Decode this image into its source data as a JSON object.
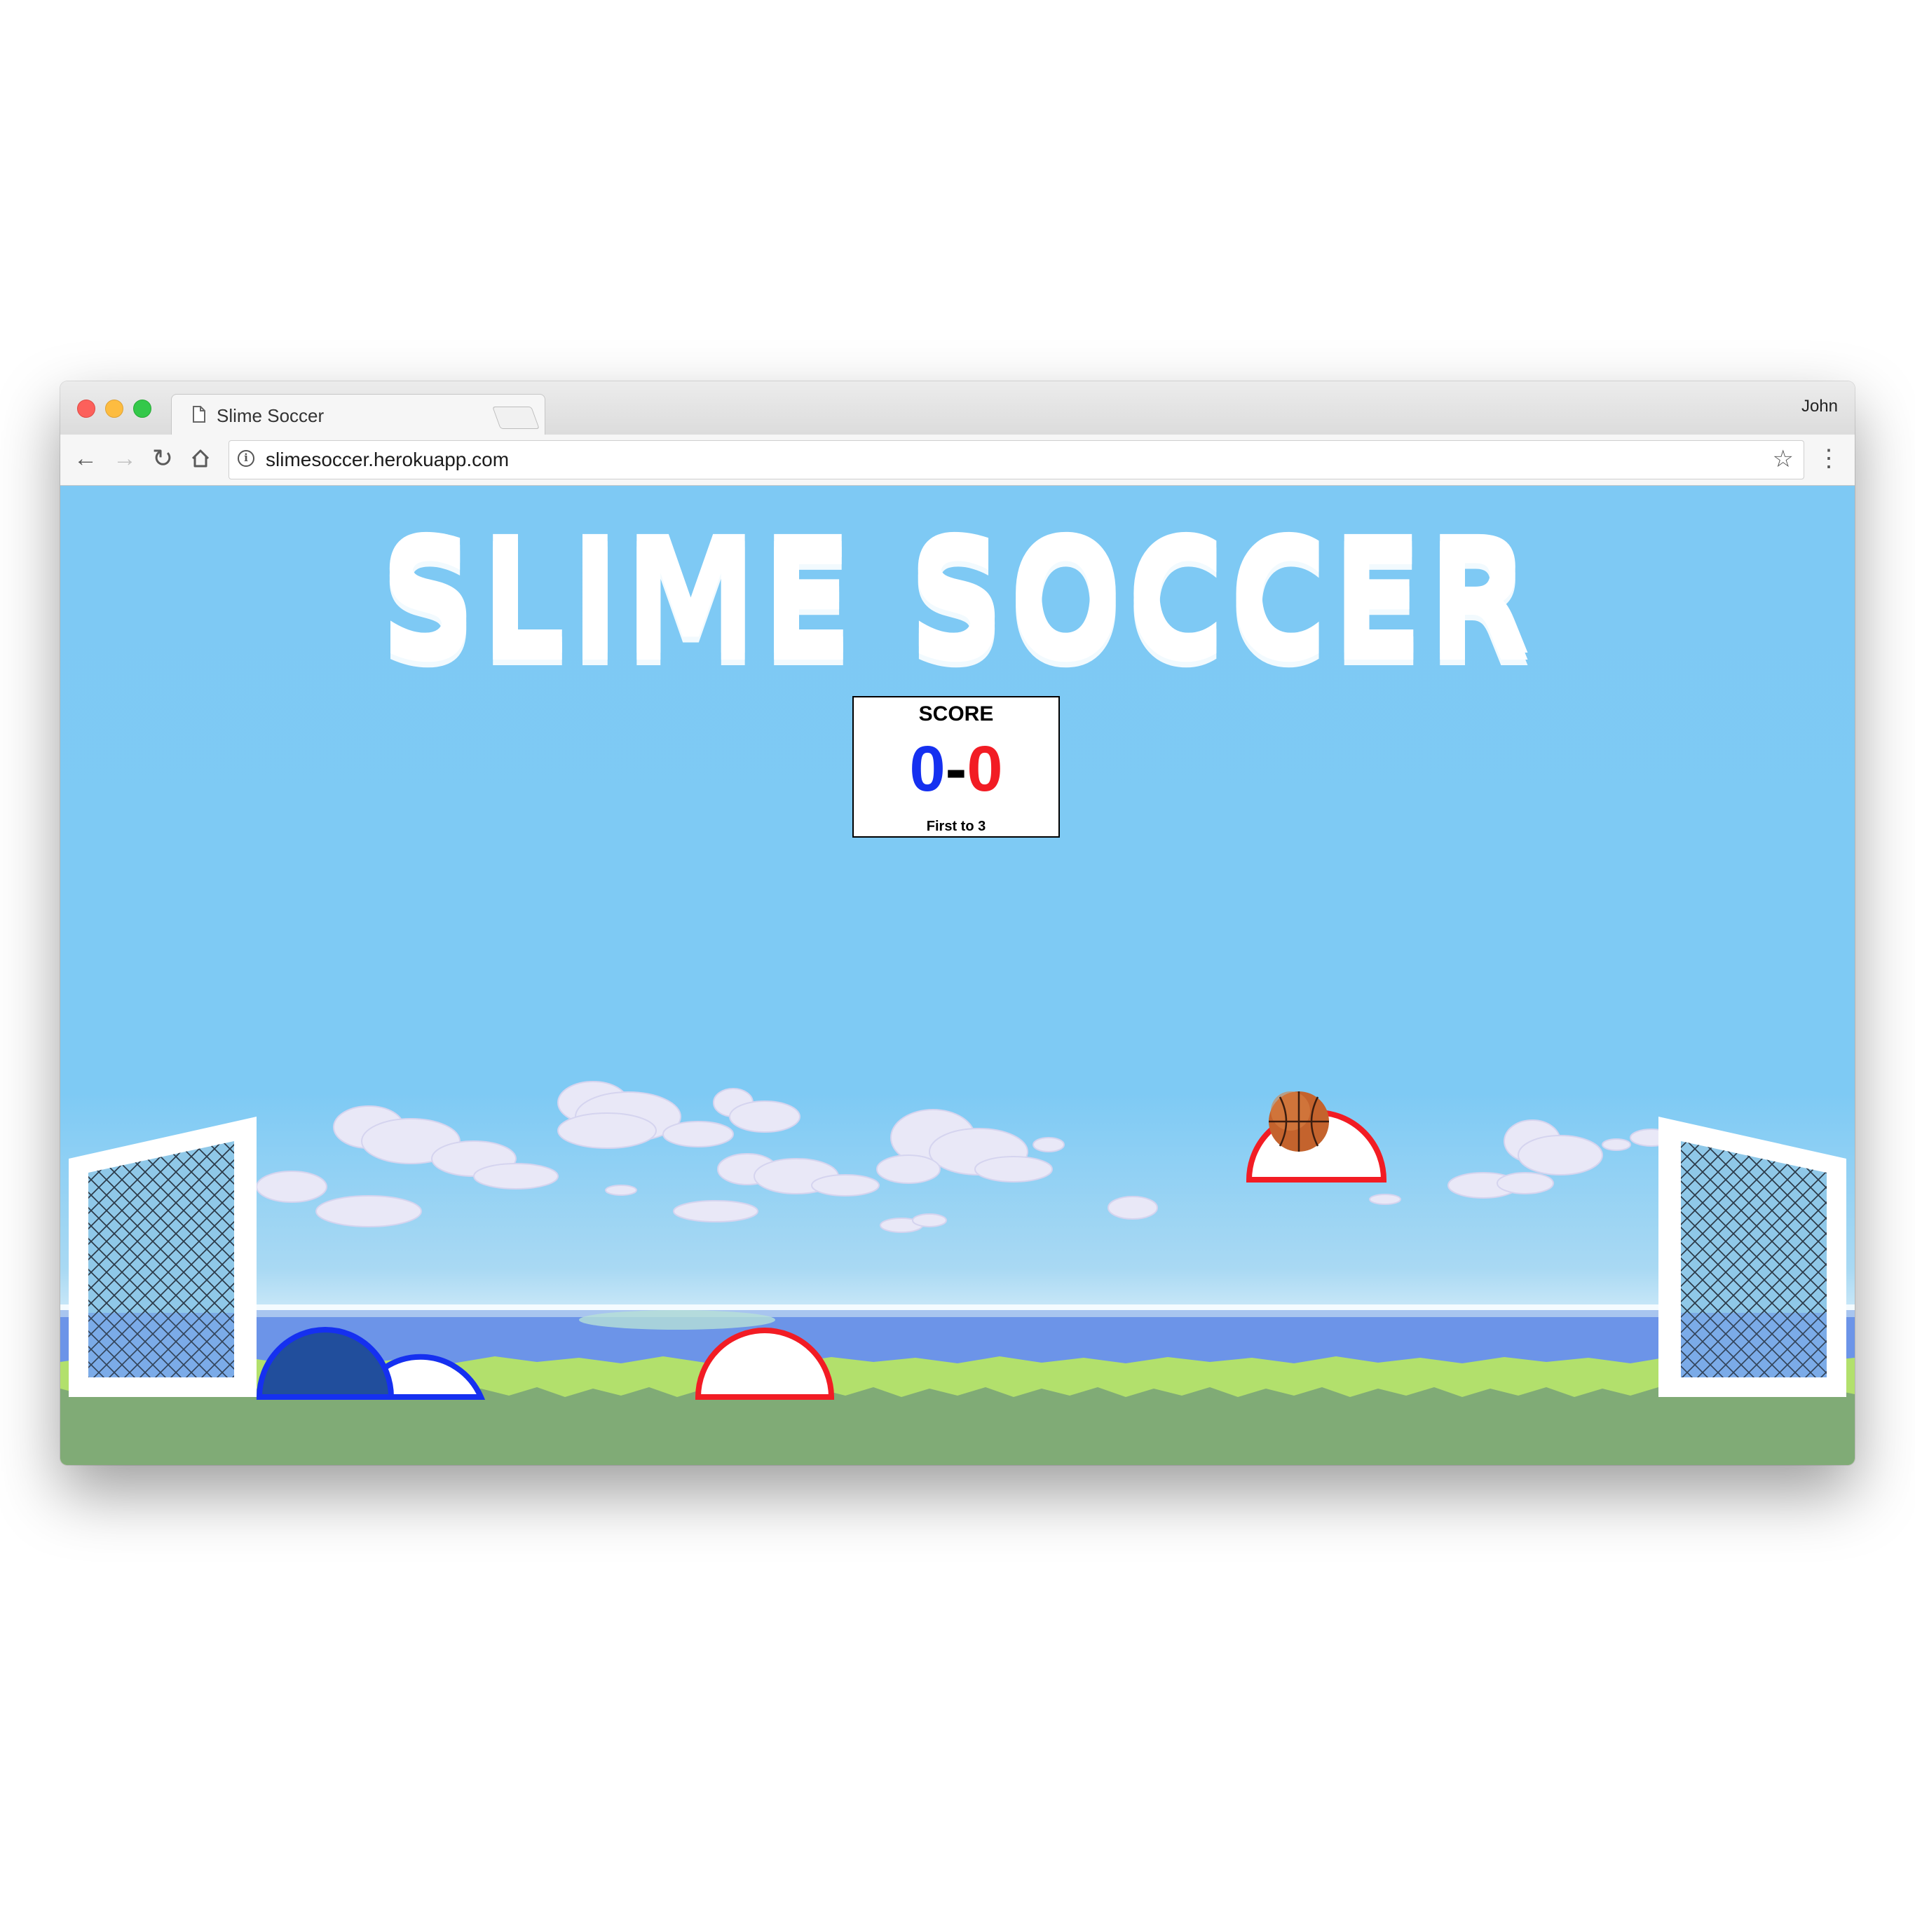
{
  "browser": {
    "tab_title": "Slime Soccer",
    "tab_close": "×",
    "profile_name": "John",
    "url": "slimesoccer.herokuapp.com",
    "icons": [
      "back-arrow-icon",
      "forward-arrow-icon",
      "reload-icon",
      "home-icon",
      "info-icon",
      "star-icon",
      "menu-icon",
      "page-icon"
    ]
  },
  "game": {
    "title": "SLIME SOCCER",
    "scoreboard": {
      "label": "SCORE",
      "blue_score": "0",
      "separator": "-",
      "red_score": "0",
      "rule": "First to 3"
    },
    "colors": {
      "sky": "#7ec9f4",
      "blue_team": "#1530f0",
      "blue_fill": "#214e9c",
      "red_team": "#f21c24",
      "grass": "#b2e06c",
      "ground": "#80ab76",
      "sea": "#6c94e8"
    }
  }
}
